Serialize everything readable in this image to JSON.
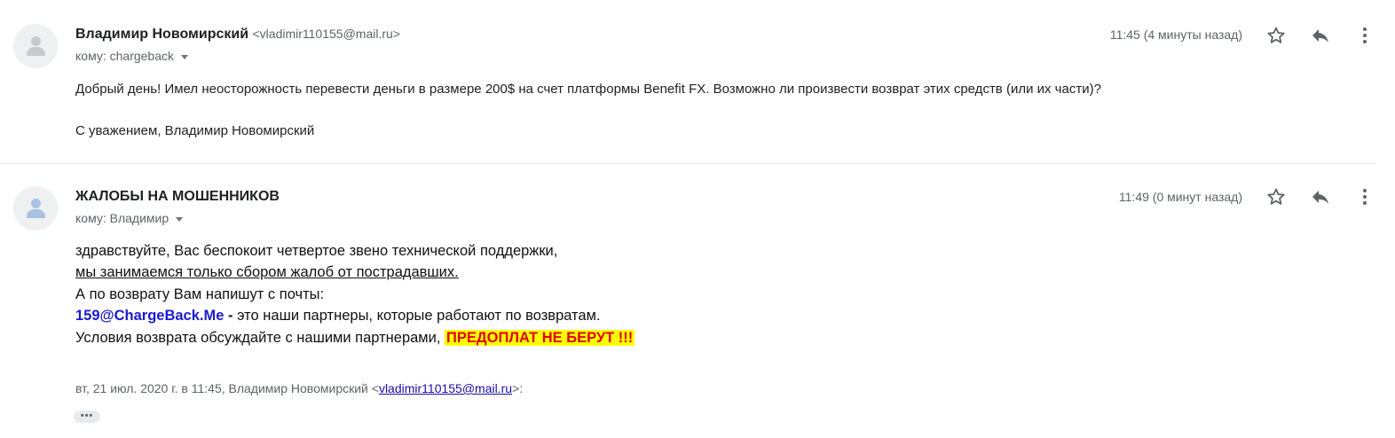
{
  "messages": [
    {
      "sender_name": "Владимир Новомирский",
      "sender_email": "<vladimir110155@mail.ru>",
      "to_line": "кому: chargeback",
      "time": "11:45 (4 минуты назад)",
      "body": [
        "Добрый день! Имел неосторожность перевести деньги в размере 200$ на счет платформы Benefit FX. Возможно ли произвести возврат этих средств (или их части)?",
        "С уважением, Владимир Новомирский"
      ]
    },
    {
      "sender_name": "ЖАЛОБЫ НА МОШЕННИКОВ",
      "to_line": "кому: Владимир",
      "time": "11:49 (0 минут назад)",
      "body": {
        "line1": "здравствуйте, Вас беспокоит четвертое звено технической поддержки,",
        "line2": "мы занимаемся только сбором жалоб от пострадавших.",
        "line3": "А по возврату Вам напишут с почты:",
        "line4_email": "159@ChargeBack.Me",
        "line4_dash": " -",
        "line4_rest": " это наши партнеры, которые работают по возвратам.",
        "line5_text": "Условия возврата обсуждайте с нашими партнерами, ",
        "line5_highlight": "ПРЕДОПЛАТ НЕ БЕРУТ !!!"
      },
      "quote_header_prefix": "вт, 21 июл. 2020 г. в 11:45, Владимир Новомирский <",
      "quote_header_email": "vladimir110155@mail.ru",
      "quote_header_suffix": ">:",
      "expand_label": "•••"
    }
  ],
  "icons": {
    "star": "star-icon",
    "reply": "reply-icon",
    "more": "more-vert-icon",
    "avatar": "person-icon"
  },
  "colors": {
    "link_blue": "#1a1ad2",
    "warning_red": "#e00000",
    "highlight_yellow": "#ffff00"
  }
}
